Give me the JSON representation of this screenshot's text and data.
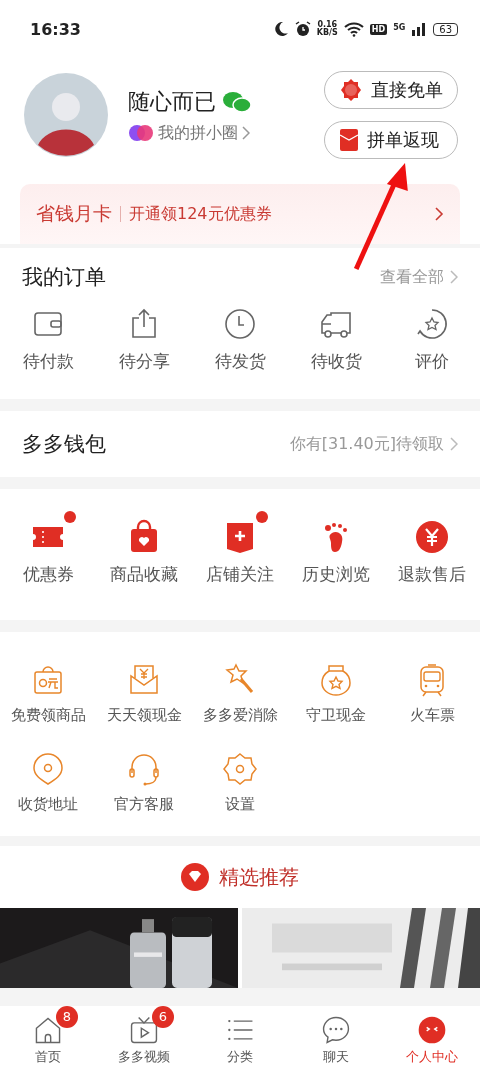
{
  "status_bar": {
    "time": "16:33",
    "speed": "0.16",
    "speed_unit": "KB/S",
    "hd": "HD",
    "network": "5G",
    "battery": "63"
  },
  "profile": {
    "name": "随心而已",
    "circle_link": "我的拼小圈",
    "buttons": [
      {
        "label": "直接免单"
      },
      {
        "label": "拼单返现"
      }
    ]
  },
  "promo": {
    "title": "省钱月卡",
    "text": "开通领124元优惠券"
  },
  "orders": {
    "title": "我的订单",
    "link": "查看全部",
    "items": [
      {
        "label": "待付款"
      },
      {
        "label": "待分享"
      },
      {
        "label": "待发货"
      },
      {
        "label": "待收货"
      },
      {
        "label": "评价"
      }
    ]
  },
  "wallet": {
    "title": "多多钱包",
    "note": "你有[31.40元]待领取"
  },
  "shortcuts": [
    {
      "label": "优惠券",
      "dot": true
    },
    {
      "label": "商品收藏",
      "dot": false
    },
    {
      "label": "店铺关注",
      "dot": true
    },
    {
      "label": "历史浏览",
      "dot": false
    },
    {
      "label": "退款售后",
      "dot": false
    }
  ],
  "services": [
    {
      "label": "免费领商品"
    },
    {
      "label": "天天领现金"
    },
    {
      "label": "多多爱消除"
    },
    {
      "label": "守卫现金"
    },
    {
      "label": "火车票"
    },
    {
      "label": "收货地址"
    },
    {
      "label": "官方客服"
    },
    {
      "label": "设置"
    }
  ],
  "recommend": {
    "title": "精选推荐"
  },
  "tab_bar": [
    {
      "label": "首页",
      "badge": "8",
      "selected": false
    },
    {
      "label": "多多视频",
      "badge": "6",
      "selected": false
    },
    {
      "label": "分类",
      "selected": false
    },
    {
      "label": "聊天",
      "selected": false
    },
    {
      "label": "个人中心",
      "selected": true
    }
  ]
}
